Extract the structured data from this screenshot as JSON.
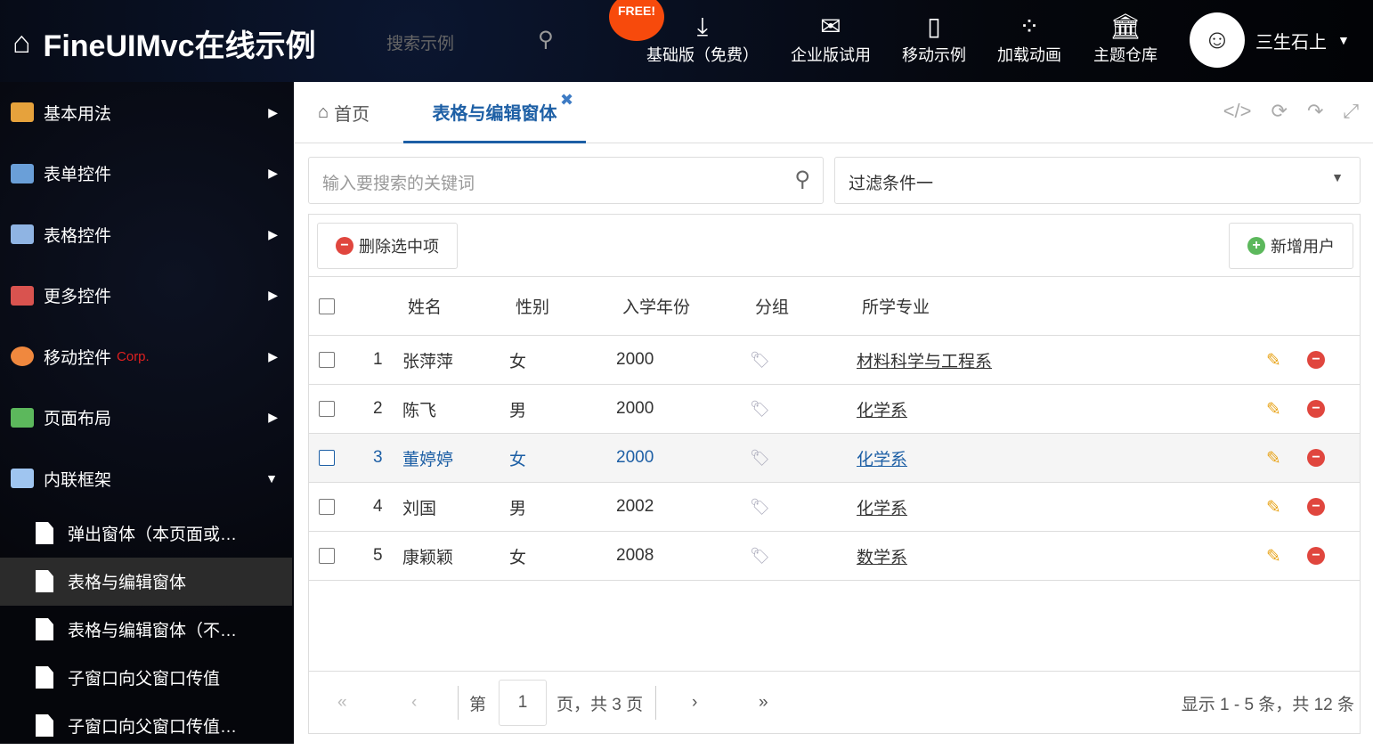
{
  "header": {
    "title": "FineUIMvc在线示例",
    "search_placeholder": "搜索示例",
    "free_badge": "FREE!",
    "items": [
      {
        "label": "基础版（免费）",
        "icon": "download-icon"
      },
      {
        "label": "企业版试用",
        "icon": "envelope-icon"
      },
      {
        "label": "移动示例",
        "icon": "mobile-icon"
      },
      {
        "label": "加载动画",
        "icon": "spinner-icon"
      },
      {
        "label": "主题仓库",
        "icon": "bank-icon"
      }
    ],
    "user": "三生石上"
  },
  "sidebar": {
    "items": [
      {
        "label": "基本用法",
        "color": "#e6a23c"
      },
      {
        "label": "表单控件",
        "color": "#6a9fd8"
      },
      {
        "label": "表格控件",
        "color": "#8fb4e3"
      },
      {
        "label": "更多控件",
        "color": "#d9534f"
      },
      {
        "label": "移动控件",
        "badge": "Corp.",
        "color": "#f0883e"
      },
      {
        "label": "页面布局",
        "color": "#5cb85c"
      },
      {
        "label": "内联框架",
        "color": "#9fc5f0"
      }
    ],
    "subitems": [
      "弹出窗体（本页面或…",
      "表格与编辑窗体",
      "表格与编辑窗体（不…",
      "子窗口向父窗口传值",
      "子窗口向父窗口传值…"
    ]
  },
  "tabs": {
    "home": "首页",
    "active": "表格与编辑窗体"
  },
  "search": {
    "placeholder": "输入要搜索的关键词"
  },
  "filter": {
    "value": "过滤条件一"
  },
  "toolbar": {
    "delete": "删除选中项",
    "add": "新增用户"
  },
  "grid": {
    "columns": [
      "姓名",
      "性别",
      "入学年份",
      "分组",
      "所学专业"
    ],
    "rows": [
      {
        "n": "1",
        "name": "张萍萍",
        "gender": "女",
        "year": "2000",
        "major": "材料科学与工程系"
      },
      {
        "n": "2",
        "name": "陈飞",
        "gender": "男",
        "year": "2000",
        "major": "化学系"
      },
      {
        "n": "3",
        "name": "董婷婷",
        "gender": "女",
        "year": "2000",
        "major": "化学系"
      },
      {
        "n": "4",
        "name": "刘国",
        "gender": "男",
        "year": "2002",
        "major": "化学系"
      },
      {
        "n": "5",
        "name": "康颖颖",
        "gender": "女",
        "year": "2008",
        "major": "数学系"
      }
    ]
  },
  "pager": {
    "prefix": "第",
    "page": "1",
    "suffix": "页，共 3 页",
    "summary": "显示 1 - 5 条，共 12 条"
  }
}
